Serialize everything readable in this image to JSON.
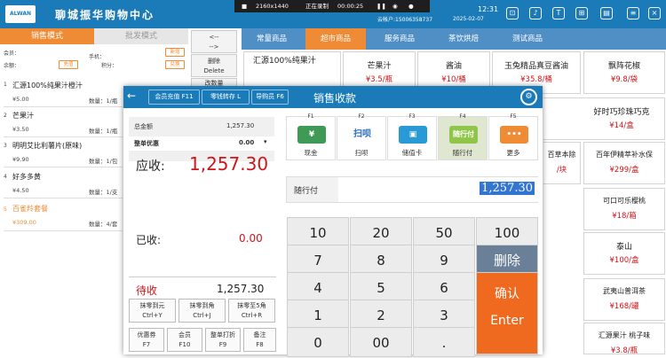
{
  "header": {
    "logo_text": "ALWAN",
    "shop_name": "聊城振华购物中心",
    "recording": {
      "resolution": "2160x1440",
      "status": "正在录制",
      "timer": "00:00:25"
    },
    "account": "云帐户:15006358737",
    "time": "12:31",
    "date": "2025-02-07"
  },
  "left_panel": {
    "tab_retail": "销售模式",
    "tab_wholesale": "批发模式",
    "member_label": "会员：",
    "member_btn": "新增",
    "phone_label": "手机：",
    "balance_label": "余额：",
    "recharge_btn": "充值",
    "points_label": "积分：",
    "points_btn": "兑换",
    "items": [
      {
        "index": "1",
        "name": "汇源100%纯果汁橙汁",
        "price": "¥5.00",
        "qty": "数量：1/瓶"
      },
      {
        "index": "2",
        "name": "芒果汁",
        "price": "¥3.50",
        "qty": "数量：1/瓶"
      },
      {
        "index": "3",
        "name": "明明艾比利薯片(原味)",
        "price": "¥9.90",
        "qty": "数量：1/包"
      },
      {
        "index": "4",
        "name": "好多多黄",
        "price": "¥4.50",
        "qty": "数量：1/支"
      },
      {
        "index": "5",
        "name": "百雀羚套餐",
        "price": "¥309.00",
        "qty": "数量：4/套"
      }
    ],
    "side_btn1_line1": "<--",
    "side_btn1_line2": "-->",
    "side_delete_line1": "删除",
    "side_delete_line2": "Delete",
    "side_btn3_line1": "改数量"
  },
  "categories": [
    "常量商品",
    "超市商品",
    "服务商品",
    "茶饮烘焙",
    "测试商品"
  ],
  "products": [
    {
      "name": "汇源100%纯果汁",
      "price": ""
    },
    {
      "name": "芒果汁",
      "price": "¥3.5/瓶"
    },
    {
      "name": "酱油",
      "price": "¥10/桶"
    },
    {
      "name": "玉兔精品真豆酱油",
      "price": "¥35.8/桶"
    },
    {
      "name": "飘阵花椒",
      "price": "¥9.8/袋"
    },
    {
      "name": "好时巧珍珠巧克",
      "price": ""
    },
    {
      "name": "¥14/盒",
      "price": ""
    },
    {
      "name": "百草本除",
      "price": ""
    },
    {
      "name": "百年伊精萃补水保",
      "price": "¥299/盒"
    },
    {
      "name": "可口可乐樱桃",
      "price": "¥18/箱"
    },
    {
      "name": "泰山",
      "price": "¥100/盒"
    },
    {
      "name": "武夷山普洱茶",
      "price": "¥168/罐"
    },
    {
      "name": "汇源果汁 桃子味",
      "price": "¥3.8/瓶"
    }
  ],
  "dialog": {
    "tab_member": "会员充值 F11",
    "tab_change": "零钱转存 L",
    "tab_guide": "导购员 F6",
    "title": "销售收款",
    "total_label": "总金额",
    "total_value": "1,257.30",
    "discount_label": "整单优惠",
    "discount_value": "0.00",
    "receivable_label": "应收:",
    "receivable_value": "1,257.30",
    "received_label": "已收:",
    "received_value": "0.00",
    "due_label": "待收",
    "due_value": "1,257.30",
    "round_buttons": [
      {
        "line1": "抹零到元",
        "line2": "Ctrl+Y"
      },
      {
        "line1": "抹零到角",
        "line2": "Ctrl+J"
      },
      {
        "line1": "抹零至5角",
        "line2": "Ctrl+R"
      }
    ],
    "func_buttons": [
      {
        "line1": "优惠券",
        "line2": "F7"
      },
      {
        "line1": "会员",
        "line2": "F10"
      },
      {
        "line1": "整单打折",
        "line2": "F9"
      },
      {
        "line1": "备注",
        "line2": "F8"
      }
    ],
    "pay_methods": [
      {
        "key": "F1",
        "label": "现金",
        "icon": "¥"
      },
      {
        "key": "F2",
        "label": "扫呗",
        "icon": "扫呗"
      },
      {
        "key": "F3",
        "label": "储值卡",
        "icon": "▣"
      },
      {
        "key": "F4",
        "label": "随行付",
        "icon": "随行付"
      },
      {
        "key": "F5",
        "label": "更多",
        "icon": "•••"
      }
    ],
    "pay_input_label": "随行付",
    "pay_input_value": "1,257.30",
    "keys": [
      "10",
      "20",
      "50",
      "100",
      "7",
      "8",
      "9",
      "删除",
      "4",
      "5",
      "6",
      "1",
      "2",
      "3",
      "0",
      "00",
      "."
    ],
    "enter_line1": "确认",
    "enter_line2": "Enter"
  }
}
